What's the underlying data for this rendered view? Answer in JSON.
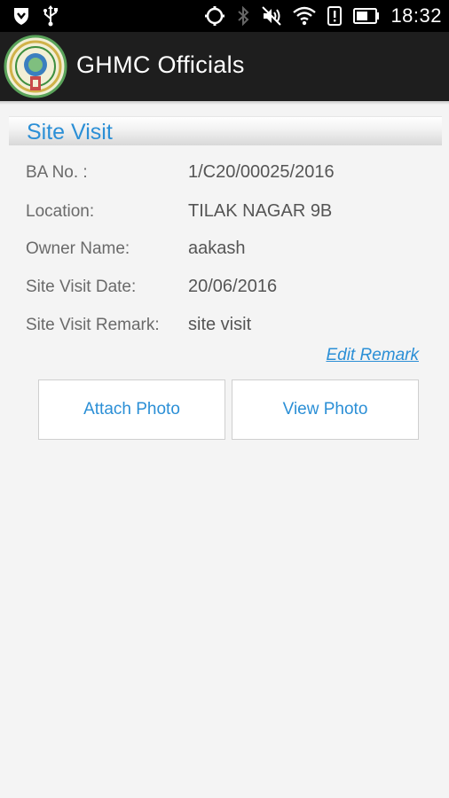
{
  "status_bar": {
    "time": "18:32",
    "icons": [
      "shield-download-icon",
      "usb-icon",
      "sync-icon",
      "bluetooth-icon",
      "mute-icon",
      "wifi-icon",
      "alert-icon",
      "battery-icon"
    ]
  },
  "app_bar": {
    "title": "GHMC Officials",
    "logo_icon": "ghmc-emblem-icon"
  },
  "section": {
    "title": "Site Visit"
  },
  "details": [
    {
      "label": "BA No. :",
      "value": "1/C20/00025/2016"
    },
    {
      "label": "Location:",
      "value": "TILAK NAGAR 9B"
    },
    {
      "label": "Owner Name:",
      "value": "aakash"
    },
    {
      "label": "Site Visit Date:",
      "value": "20/06/2016"
    },
    {
      "label": "Site Visit Remark:",
      "value": "site visit"
    }
  ],
  "edit_remark_label": "Edit Remark",
  "buttons": {
    "attach_photo": "Attach Photo",
    "view_photo": "View Photo"
  },
  "colors": {
    "accent": "#2b8fd6",
    "app_bar": "#1e1e1e",
    "background": "#f4f4f4"
  }
}
